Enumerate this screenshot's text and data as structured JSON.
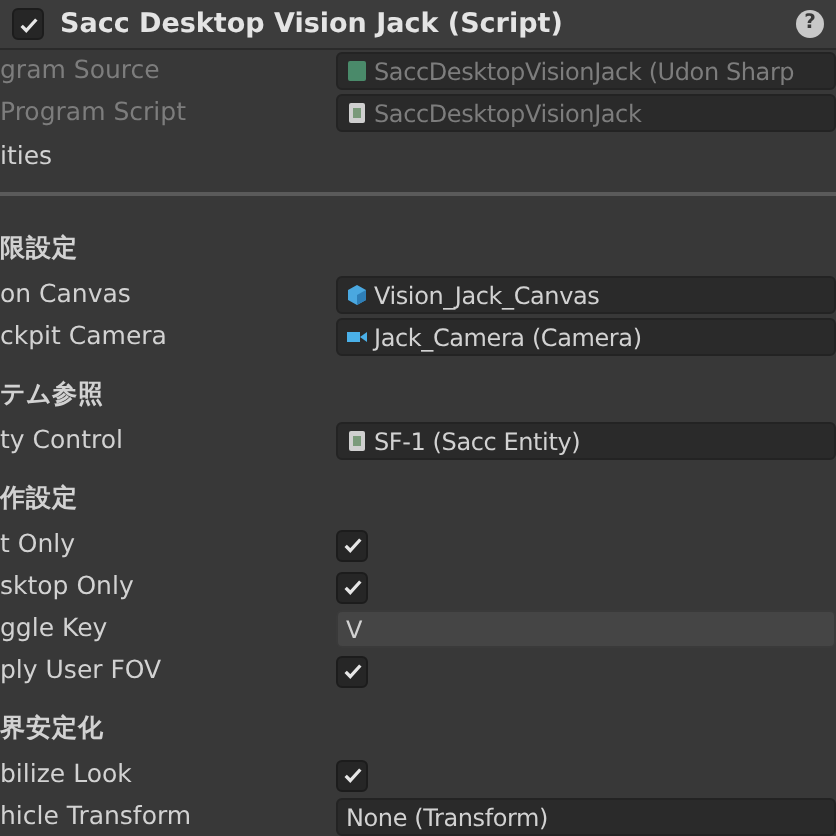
{
  "header": {
    "title": "Sacc Desktop Vision Jack (Script)",
    "enabled": true,
    "help": "?"
  },
  "rows": [
    {
      "kind": "asset",
      "label": "gram Source",
      "value": "SaccDesktopVisionJack (Udon Sharp",
      "disabled": true
    },
    {
      "kind": "script",
      "label": "Program Script",
      "value": "SaccDesktopVisionJack",
      "disabled": true
    },
    {
      "kind": "foldout",
      "label": "ities"
    },
    {
      "kind": "divider"
    },
    {
      "kind": "section",
      "label": "限設定"
    },
    {
      "kind": "model",
      "label": "on Canvas",
      "value": "Vision_Jack_Canvas",
      "disabled": false
    },
    {
      "kind": "camera",
      "label": "ckpit Camera",
      "value": "Jack_Camera (Camera)",
      "disabled": false
    },
    {
      "kind": "section",
      "label": "テム参照"
    },
    {
      "kind": "script",
      "label": "ty Control",
      "value": "SF-1 (Sacc Entity)",
      "disabled": false
    },
    {
      "kind": "section",
      "label": "作設定"
    },
    {
      "kind": "checkbox",
      "label": "t Only",
      "checked": true
    },
    {
      "kind": "checkbox",
      "label": "sktop Only",
      "checked": true
    },
    {
      "kind": "text",
      "label": "ggle Key",
      "value": "V"
    },
    {
      "kind": "checkbox",
      "label": "ply User FOV",
      "checked": true
    },
    {
      "kind": "section",
      "label": "界安定化"
    },
    {
      "kind": "checkbox",
      "label": "bilize Look",
      "checked": true
    },
    {
      "kind": "empty",
      "label": "hicle Transform",
      "value": "None (Transform)",
      "disabled": false
    }
  ]
}
